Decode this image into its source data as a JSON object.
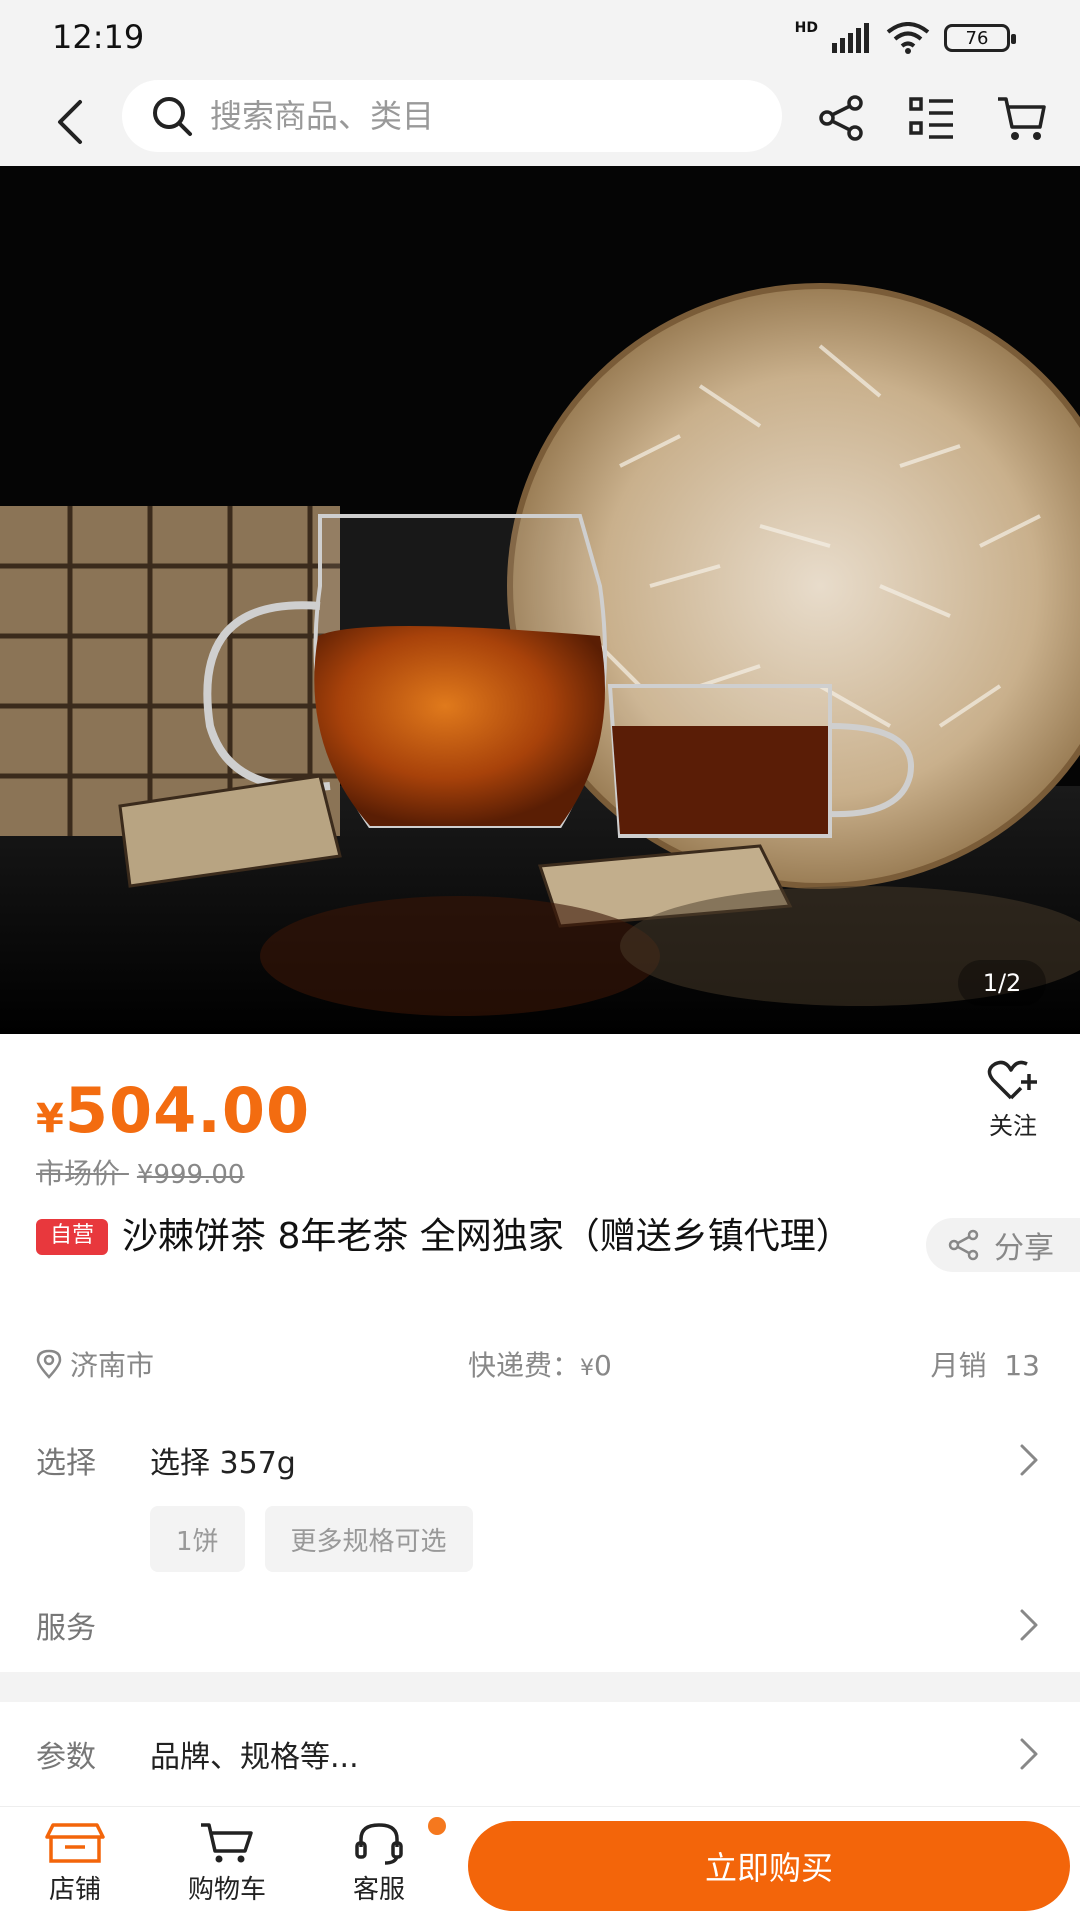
{
  "status_bar": {
    "time": "12:19",
    "network_label": "HD",
    "battery": "76"
  },
  "top_nav": {
    "search_placeholder": "搜索商品、类目"
  },
  "gallery": {
    "counter": "1/2"
  },
  "product": {
    "price_symbol": "¥",
    "price": "504.00",
    "market_price_label": "市场价",
    "market_price_symbol": "¥",
    "market_price": "999.00",
    "follow_label": "关注",
    "badge": "自营",
    "title": "沙棘饼茶 8年老茶 全网独家（赠送乡镇代理）",
    "share_label": "分享",
    "location": "济南市",
    "shipping_label": "快递费：",
    "shipping_symbol": "¥",
    "shipping_value": "0",
    "sales_label": "月销",
    "sales_count": "13"
  },
  "options": {
    "select_label": "选择",
    "select_value": "选择  357g",
    "chips": [
      "1饼",
      "更多规格可选"
    ],
    "service_label": "服务",
    "params_label": "参数",
    "params_value": "品牌、规格等..."
  },
  "bottom_bar": {
    "shop_label": "店铺",
    "cart_label": "购物车",
    "service_label": "客服",
    "buy_label": "立即购买"
  },
  "colors": {
    "accent": "#f3650a",
    "price": "#f36c10",
    "badge": "#e8383d"
  }
}
